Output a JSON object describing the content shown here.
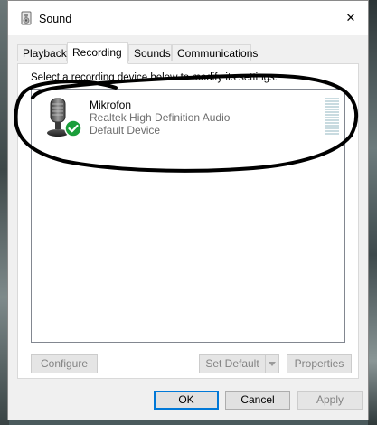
{
  "window": {
    "title": "Sound",
    "close_glyph": "✕"
  },
  "tabs": [
    {
      "label": "Playback",
      "active": false
    },
    {
      "label": "Recording",
      "active": true
    },
    {
      "label": "Sounds",
      "active": false
    },
    {
      "label": "Communications",
      "active": false
    }
  ],
  "recording": {
    "instruction": "Select a recording device below to modify its settings:",
    "devices": [
      {
        "name": "Mikrofon",
        "driver": "Realtek High Definition Audio",
        "status": "Default Device",
        "icon": "microphone-icon",
        "status_icon": "green-check-icon"
      }
    ]
  },
  "panel_buttons": {
    "configure": "Configure",
    "set_default": "Set Default",
    "properties": "Properties"
  },
  "dialog_buttons": {
    "ok": "OK",
    "cancel": "Cancel",
    "apply": "Apply"
  },
  "colors": {
    "accent": "#0078d7",
    "check_green": "#1a9e3a",
    "annotation": "#000000"
  }
}
